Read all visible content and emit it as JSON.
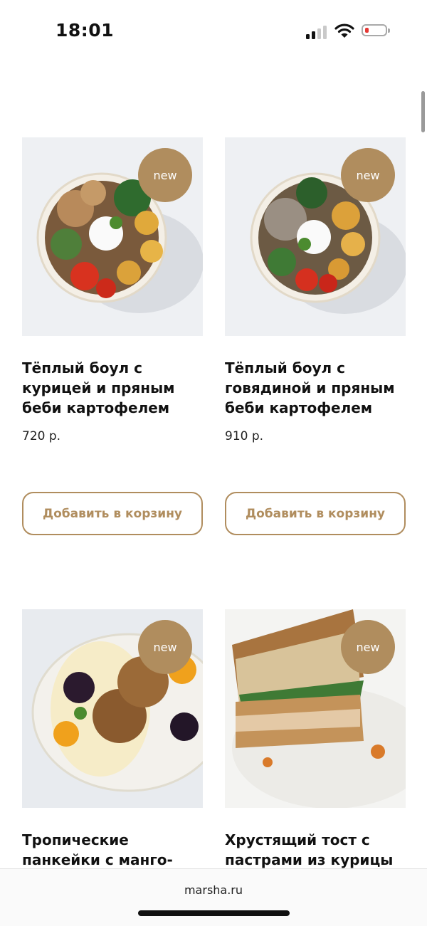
{
  "status_bar": {
    "time": "18:01"
  },
  "products": [
    {
      "badge": "new",
      "title": "Тёплый боул с курицей и пряным беби картофелем",
      "price": "720 р.",
      "add_button": "Добавить в корзину"
    },
    {
      "badge": "new",
      "title": "Тёплый боул с говядиной и пряным беби картофелем",
      "price": "910 р.",
      "add_button": "Добавить в корзину"
    },
    {
      "badge": "new",
      "title": "Тропические панкейки с манго-"
    },
    {
      "badge": "new",
      "title": "Хрустящий тост с пастрами из курицы"
    }
  ],
  "browser": {
    "url": "marsha.ru"
  },
  "colors": {
    "accent": "#b08d5e",
    "battery_low": "#e53935"
  }
}
